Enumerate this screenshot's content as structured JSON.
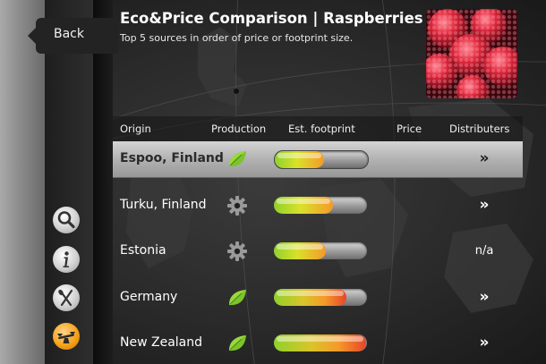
{
  "nav": {
    "back_label": "Back"
  },
  "header": {
    "title": "Eco&Price Comparison | Raspberries",
    "subtitle": "Top 5 sources in order of price or footprint size."
  },
  "table": {
    "columns": [
      "Origin",
      "Production",
      "Est. footprint",
      "Price",
      "Distributers"
    ],
    "rows": [
      {
        "origin": "Espoo, Finland",
        "production_icon": "leaf-icon",
        "footprint": 0.53,
        "price": "",
        "distributers": "»",
        "selected": true
      },
      {
        "origin": "Turku, Finland",
        "production_icon": "gear-icon",
        "footprint": 0.63,
        "price": "",
        "distributers": "»",
        "selected": false
      },
      {
        "origin": "Estonia",
        "production_icon": "gear-icon",
        "footprint": 0.56,
        "price": "",
        "distributers": "n/a",
        "selected": false
      },
      {
        "origin": "Germany",
        "production_icon": "leaf-icon",
        "footprint": 0.78,
        "price": "",
        "distributers": "»",
        "selected": false
      },
      {
        "origin": "New Zealand",
        "production_icon": "leaf-icon",
        "footprint": 0.99,
        "price": "",
        "distributers": "»",
        "selected": false
      }
    ]
  },
  "sidebar": {
    "icons": [
      {
        "name": "search-icon",
        "style": "gray",
        "active": false
      },
      {
        "name": "info-icon",
        "style": "gray",
        "active": false
      },
      {
        "name": "cutlery-icon",
        "style": "gray",
        "active": false
      },
      {
        "name": "scale-icon",
        "style": "orange",
        "active": true
      }
    ]
  },
  "colors": {
    "accent": "#f6a21c",
    "leaf": "#7cc42a",
    "bar_green": "#8fd12c",
    "bar_orange": "#f49a2a",
    "bar_red": "#e6452a"
  }
}
